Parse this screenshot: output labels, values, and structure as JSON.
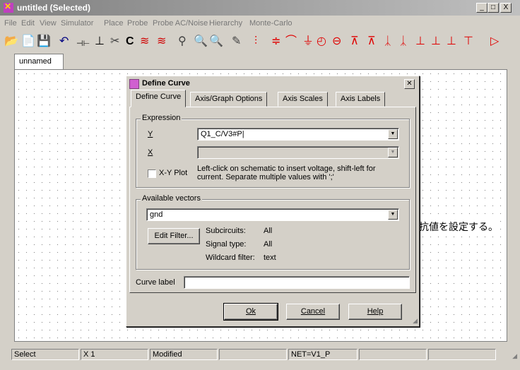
{
  "window": {
    "title": "untitled (Selected)",
    "controls": [
      "_",
      "□",
      "X"
    ]
  },
  "menu": [
    "File",
    "Edit",
    "View",
    "Simulator",
    "Place",
    "Probe",
    "Probe AC/Noise",
    "Hierarchy",
    "Monte-Carlo"
  ],
  "toolbar_glyphs": [
    "📂",
    "📄",
    "💾",
    "↶",
    "⊣⊢",
    "⊥",
    "✂",
    "C",
    "≋",
    "≋",
    "⚲",
    "🔍",
    "🔍",
    "✎",
    "⫶",
    "≑",
    "⌒",
    "⏚",
    "◴",
    "⊖",
    "⊼",
    "⊼",
    "ᛣ",
    "ᛣ",
    "⊥",
    "⊥",
    "⊥",
    "⊤",
    "▷"
  ],
  "document_tab": "unnamed",
  "canvas": {
    "annotation": "抗値を設定する。"
  },
  "dialog": {
    "title": "Define Curve",
    "tabs": [
      "Define Curve",
      "Axis/Graph Options",
      "Axis Scales",
      "Axis Labels"
    ],
    "expression_label": "Expression",
    "y_label": "Y",
    "y_value": "Q1_C/V3#P|",
    "x_label": "X",
    "x_value": "",
    "xy_plot_label": "X-Y Plot",
    "hint": [
      "Left-click on schematic to insert voltage, shift-left for",
      "current. Separate multiple values with ';'"
    ],
    "available_vectors_label": "Available vectors",
    "vector_value": "gnd",
    "edit_filter": "Edit Filter...",
    "subcircuits_label": "Subcircuits:",
    "subcircuits_value": "All",
    "signal_type_label": "Signal type:",
    "signal_type_value": "All",
    "wildcard_label": "Wildcard filter:",
    "wildcard_value": "text",
    "curve_label_label": "Curve label",
    "curve_label_value": "",
    "ok": "Ok",
    "cancel": "Cancel",
    "help": "Help"
  },
  "status": [
    "Select",
    "X    1",
    "Modified",
    "",
    "NET=V1_P",
    "",
    ""
  ]
}
